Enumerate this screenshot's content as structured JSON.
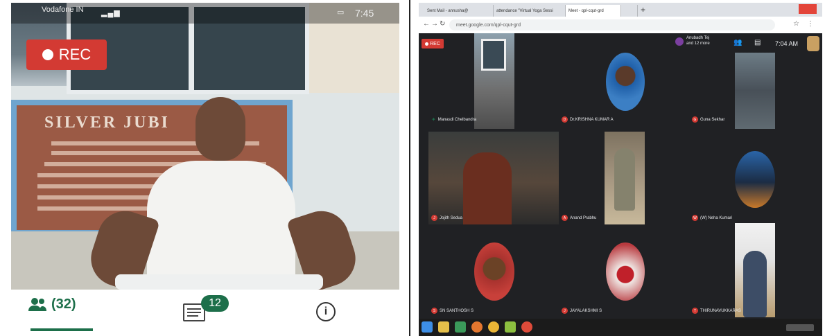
{
  "phone": {
    "status_left": "Vodafone IN",
    "status_right": "7:45",
    "rec_label": "REC",
    "plaque_title": "SILVER JUBI",
    "people_count": "(32)",
    "chat_badge": "12",
    "info_glyph": "i"
  },
  "browser": {
    "tabs": [
      {
        "label": "Sent Mail - annusha@"
      },
      {
        "label": "attendance \"Virtual Yoga Sessi"
      },
      {
        "label": "Meet - qpl-cqut-grd"
      },
      {
        "label": ""
      }
    ],
    "url": "meet.google.com/qpl-cqut-grd",
    "rec_label": "REC",
    "presenter_line1": "Anubadh Tej",
    "presenter_line2": "and 12 more",
    "meeting_time": "7:04 AM",
    "participants": [
      {
        "name": "Manasdi Chelbandra",
        "initial": "M"
      },
      {
        "name": "Dr.KRISHNA KUMAR A",
        "initial": "D"
      },
      {
        "name": "Guna Sekhar",
        "initial": "G"
      },
      {
        "name": "Jojith Sedua",
        "initial": "J"
      },
      {
        "name": "Anand Prabhu",
        "initial": "A"
      },
      {
        "name": "(W) Neha Kumari",
        "initial": "W"
      },
      {
        "name": "SN SANTHOSH S",
        "initial": "S"
      },
      {
        "name": "JAYALAKSHMI S",
        "initial": "J"
      },
      {
        "name": "THIRUNAVUKKARAS",
        "initial": "T"
      }
    ]
  },
  "colors": {
    "rec_red": "#d33a33",
    "meet_green": "#1d6f4a",
    "meet_background": "#202124"
  }
}
